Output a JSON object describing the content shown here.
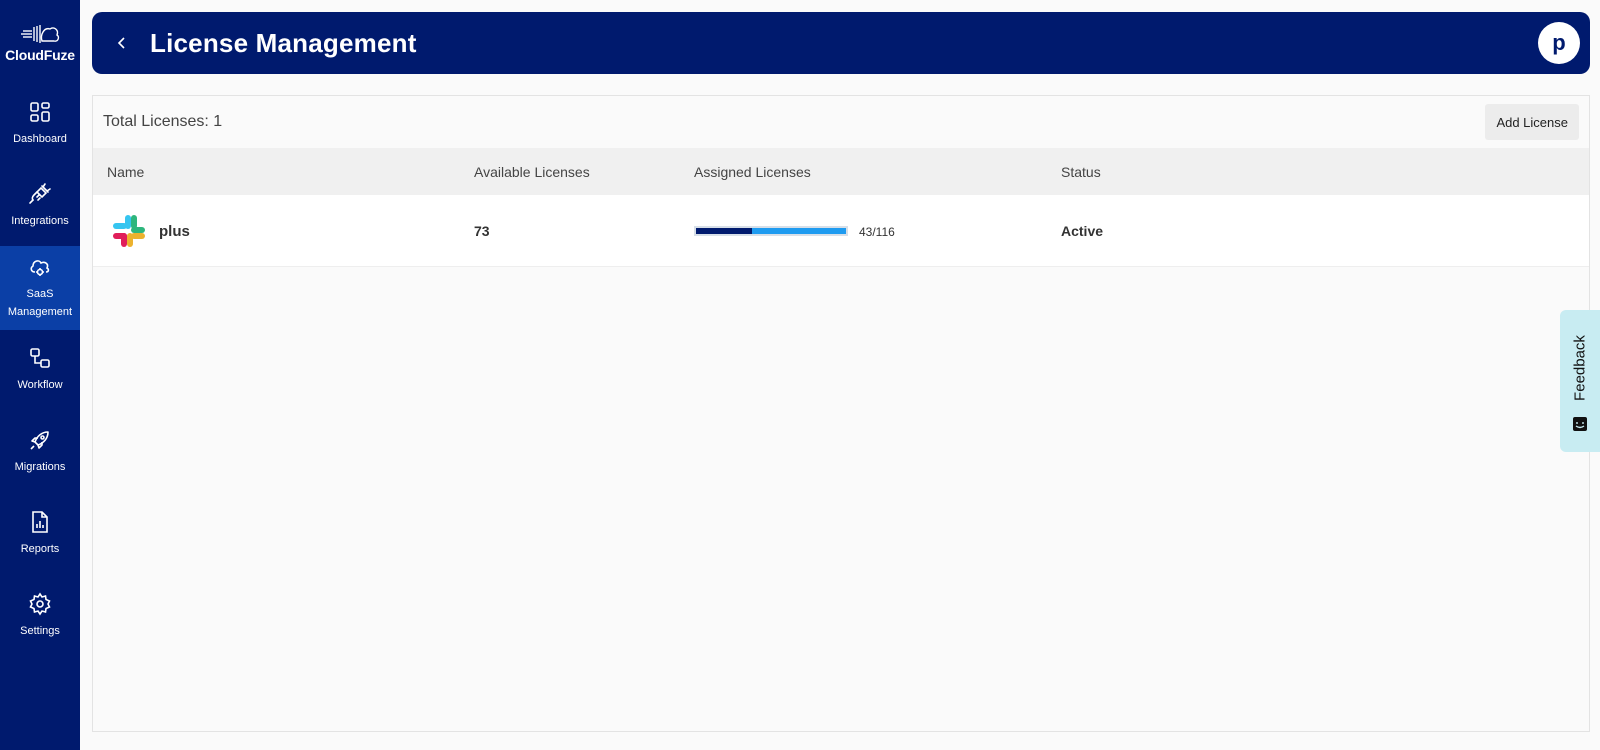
{
  "sidebar": {
    "logo": "CloudFuze",
    "items": [
      {
        "label": "Dashboard",
        "icon": "dashboard-icon",
        "active": false
      },
      {
        "label": "Integrations",
        "icon": "plug-icon",
        "active": false
      },
      {
        "label": "SaaS Management",
        "icon": "cloud-gear-icon",
        "active": true
      },
      {
        "label": "Workflow",
        "icon": "workflow-icon",
        "active": false
      },
      {
        "label": "Migrations",
        "icon": "rocket-icon",
        "active": false
      },
      {
        "label": "Reports",
        "icon": "report-icon",
        "active": false
      },
      {
        "label": "Settings",
        "icon": "gear-icon",
        "active": false
      }
    ]
  },
  "header": {
    "title": "License Management",
    "avatar_initial": "p"
  },
  "panel": {
    "total_label": "Total Licenses: 1",
    "add_button": "Add License",
    "columns": [
      "Name",
      "Available Licenses",
      "Assigned Licenses",
      "Status"
    ],
    "rows": [
      {
        "icon": "slack-icon",
        "name": "plus",
        "available": "73",
        "assigned_text": "43/116",
        "assigned_fraction": 0.37,
        "status": "Active"
      }
    ]
  },
  "feedback": {
    "label": "Feedback"
  },
  "colors": {
    "navy": "#001a6e",
    "active_nav": "#0b3fa6",
    "bar_blue": "#1e9bf0",
    "feedback_bg": "#c8ecf2"
  }
}
